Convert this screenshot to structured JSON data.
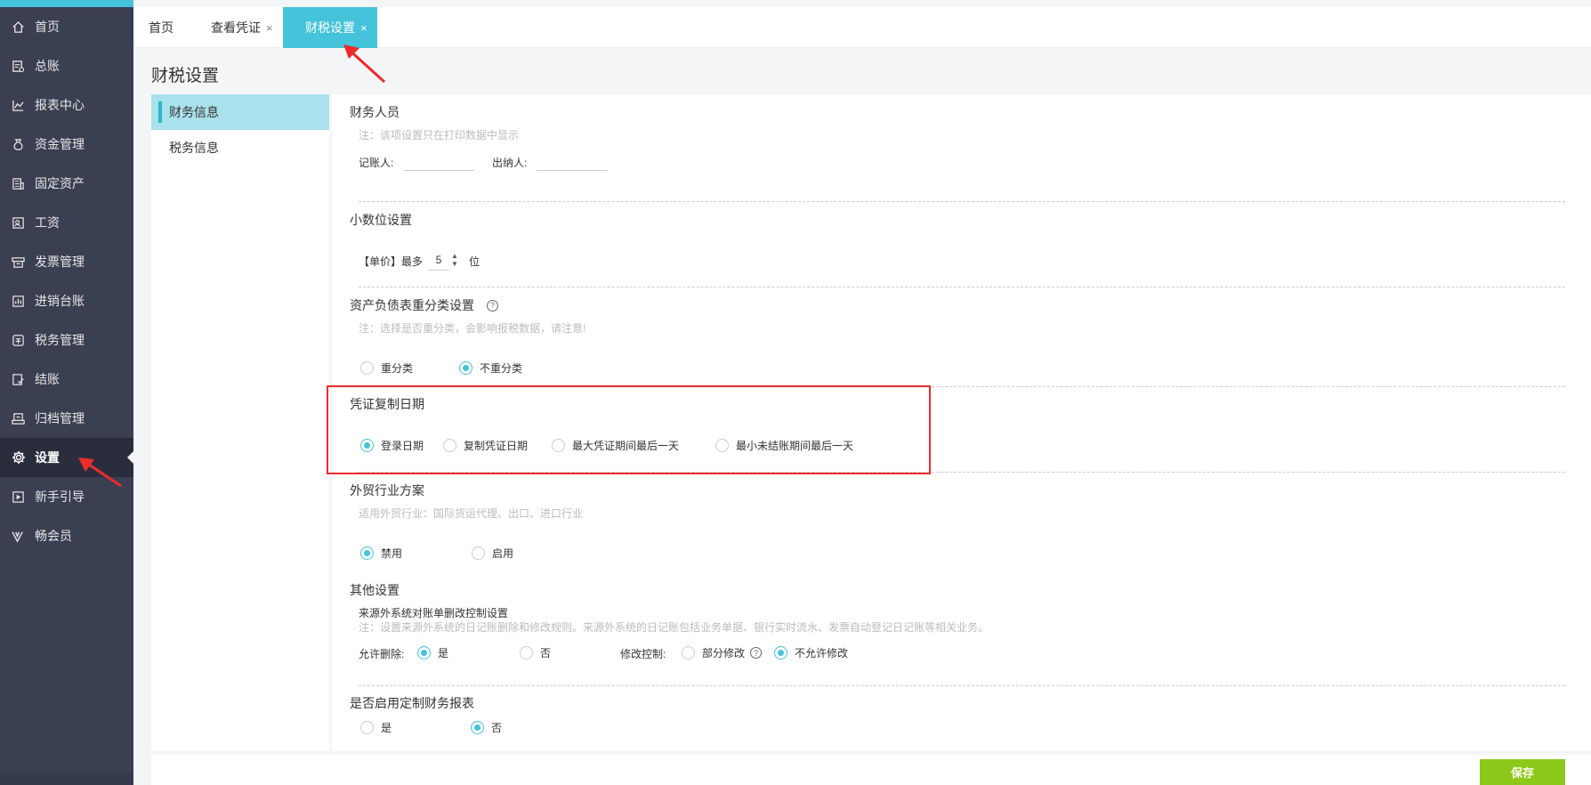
{
  "sidebar": {
    "items": [
      {
        "label": "首页",
        "icon": "home-icon"
      },
      {
        "label": "总账",
        "icon": "ledger-icon"
      },
      {
        "label": "报表中心",
        "icon": "report-icon"
      },
      {
        "label": "资金管理",
        "icon": "money-bag-icon"
      },
      {
        "label": "固定资产",
        "icon": "building-icon"
      },
      {
        "label": "工资",
        "icon": "salary-icon"
      },
      {
        "label": "发票管理",
        "icon": "invoice-icon"
      },
      {
        "label": "进销台账",
        "icon": "inventory-icon"
      },
      {
        "label": "税务管理",
        "icon": "tax-icon"
      },
      {
        "label": "结账",
        "icon": "checkout-icon"
      },
      {
        "label": "归档管理",
        "icon": "archive-icon"
      },
      {
        "label": "设置",
        "icon": "gear-icon"
      },
      {
        "label": "新手引导",
        "icon": "guide-video-icon"
      },
      {
        "label": "畅会员",
        "icon": "vip-icon"
      }
    ],
    "active_index": 11
  },
  "tabs": [
    {
      "label": "首页",
      "closable": false
    },
    {
      "label": "查看凭证",
      "closable": true
    },
    {
      "label": "财税设置",
      "closable": true,
      "active": true
    }
  ],
  "close_glyph": "×",
  "page_title": "财税设置",
  "submenu": [
    {
      "label": "财务信息",
      "active": true
    },
    {
      "label": "税务信息",
      "active": false
    }
  ],
  "finance_staff": {
    "title": "财务人员",
    "note": "注：该项设置只在打印数据中显示",
    "bookkeeper_label": "记账人:",
    "bookkeeper_value": "",
    "cashier_label": "出纳人:",
    "cashier_value": ""
  },
  "decimal": {
    "title": "小数位设置",
    "prefix": "【单价】最多",
    "value": "5",
    "suffix": "位"
  },
  "reclassify": {
    "title": "资产负债表重分类设置",
    "note": "注：选择是否重分类，会影响报税数据，请注意!",
    "options": [
      "重分类",
      "不重分类"
    ],
    "selected": 1
  },
  "voucher_copy_date": {
    "title": "凭证复制日期",
    "options": [
      "登录日期",
      "复制凭证日期",
      "最大凭证期间最后一天",
      "最小未结账期间最后一天"
    ],
    "selected": 0
  },
  "foreign_trade": {
    "title": "外贸行业方案",
    "note": "适用外贸行业：国际货运代理、出口、进口行业",
    "options": [
      "禁用",
      "启用"
    ],
    "selected": 0
  },
  "other": {
    "title": "其他设置",
    "subtitle": "来源外系统对账单删改控制设置",
    "note": "注：设置来源外系统的日记账删除和修改规则。来源外系统的日记账包括业务单据、银行实时流水、发票自动登记日记账等相关业务。",
    "delete_label": "允许删除:",
    "delete_options": [
      "是",
      "否"
    ],
    "delete_selected": 0,
    "modify_label": "修改控制:",
    "modify_options": [
      "部分修改",
      "不允许修改"
    ],
    "modify_selected": 1
  },
  "custom_report": {
    "title": "是否启用定制财务报表",
    "options": [
      "是",
      "否"
    ],
    "selected": 1
  },
  "save_label": "保存",
  "colors": {
    "sidebar_bg": "#3a3f51",
    "accent": "#44c3da",
    "save_btn": "#8cc91a",
    "highlight_box": "#ee2b2b"
  }
}
